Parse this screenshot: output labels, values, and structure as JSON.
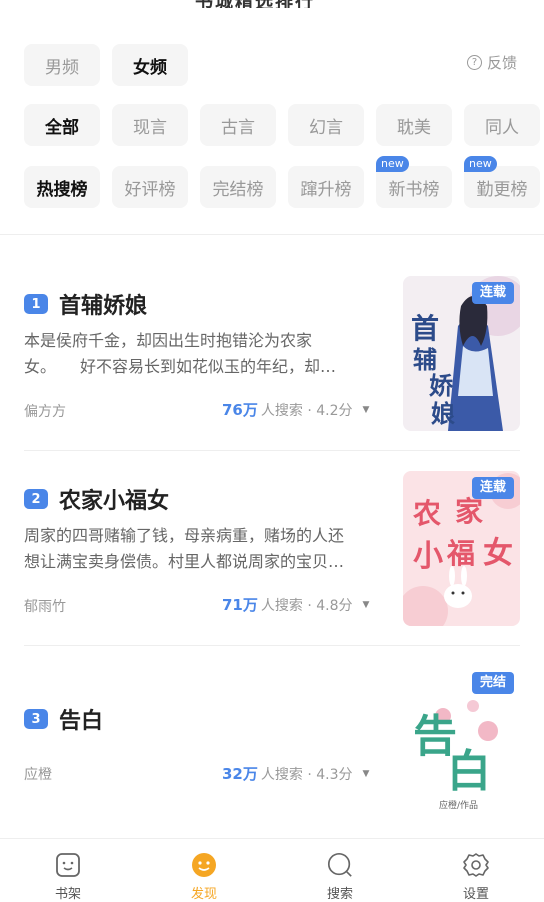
{
  "header": {
    "clipped_title": "书城精选排行"
  },
  "gender_tabs": [
    "男频",
    "女频"
  ],
  "gender_active": 1,
  "feedback_label": "反馈",
  "genre_tabs": [
    "全部",
    "现言",
    "古言",
    "幻言",
    "耽美",
    "同人"
  ],
  "genre_active": 0,
  "rank_tabs": [
    {
      "label": "热搜榜",
      "badge": ""
    },
    {
      "label": "好评榜",
      "badge": ""
    },
    {
      "label": "完结榜",
      "badge": ""
    },
    {
      "label": "蹿升榜",
      "badge": ""
    },
    {
      "label": "新书榜",
      "badge": "new"
    },
    {
      "label": "勤更榜",
      "badge": "new"
    }
  ],
  "rank_active": 0,
  "books": [
    {
      "rank": "1",
      "title": "首辅娇娘",
      "desc_line1": "本是侯府千金，却因出生时抱错沦为农家",
      "desc_line2": "女。　　好不容易长到如花似玉的年纪，却…",
      "author": "偏方方",
      "searches": "76万",
      "search_suffix": "人搜索 · 4.2分",
      "status": "连载"
    },
    {
      "rank": "2",
      "title": "农家小福女",
      "desc_line1": "周家的四哥赌输了钱，母亲病重，赌场的人还",
      "desc_line2": "想让满宝卖身偿债。村里人都说周家的宝贝…",
      "author": "郁雨竹",
      "searches": "71万",
      "search_suffix": "人搜索 · 4.8分",
      "status": "连载"
    },
    {
      "rank": "3",
      "title": "告白",
      "desc_line1": "",
      "desc_line2": "",
      "author": "应橙",
      "searches": "32万",
      "search_suffix": "人搜索 · 4.3分",
      "status": "完结"
    }
  ],
  "cover_art": {
    "book1_text": "首辅娇娘",
    "book2_text": "农家小福女",
    "book3_text": "告白",
    "book3_caption": "应橙/作品"
  },
  "tabbar": [
    {
      "label": "书架",
      "icon": "bookshelf-icon"
    },
    {
      "label": "发现",
      "icon": "discover-icon"
    },
    {
      "label": "搜索",
      "icon": "search-icon"
    },
    {
      "label": "设置",
      "icon": "settings-icon"
    }
  ],
  "colors": {
    "accent": "#4a86e8",
    "active_tab": "#f5a623"
  }
}
